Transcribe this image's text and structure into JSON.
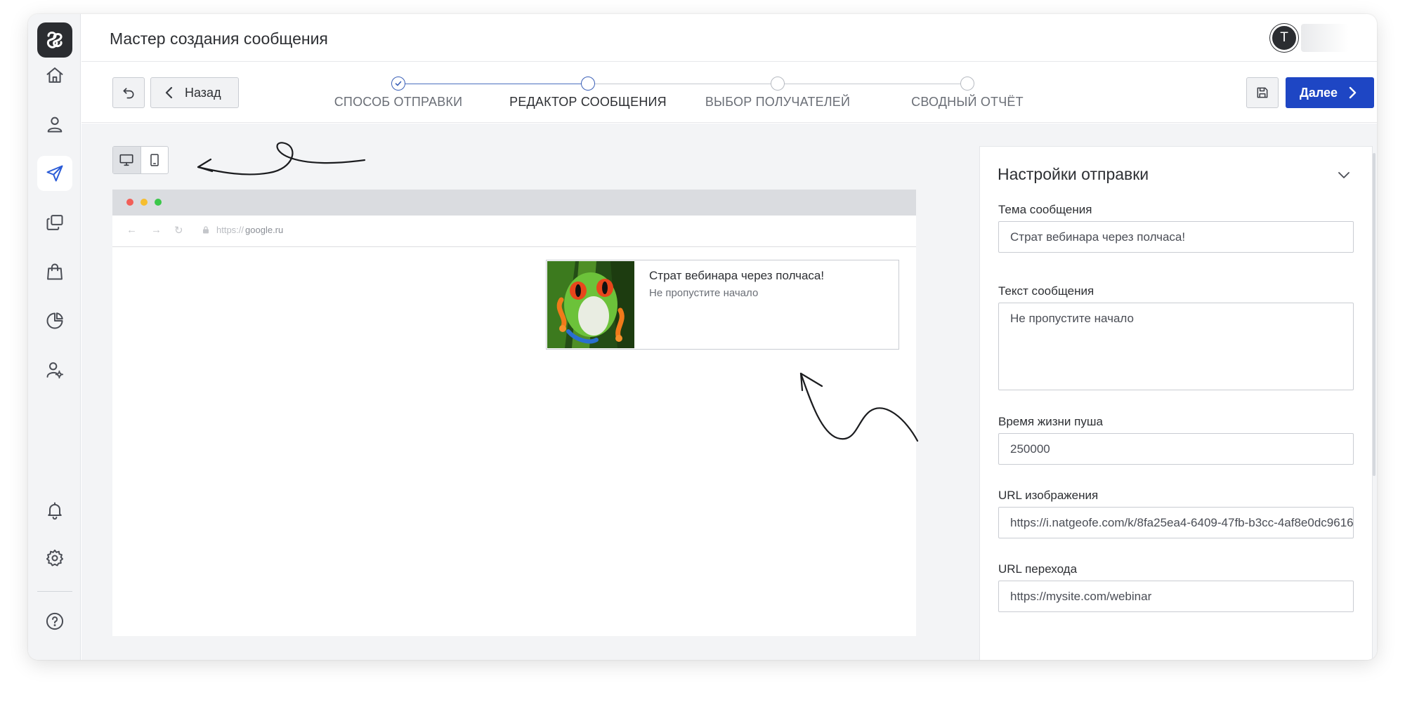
{
  "header": {
    "title": "Мастер создания сообщения",
    "avatar_initial": "T"
  },
  "sidebar": {
    "items": [
      {
        "icon": "home-icon"
      },
      {
        "icon": "user-icon"
      },
      {
        "icon": "send-icon",
        "active": true
      },
      {
        "icon": "copy-icon"
      },
      {
        "icon": "bag-icon"
      },
      {
        "icon": "pie-chart-icon"
      },
      {
        "icon": "user-settings-icon"
      }
    ],
    "bottom_items": [
      {
        "icon": "bell-icon"
      },
      {
        "icon": "gear-icon"
      },
      {
        "icon": "help-icon"
      }
    ]
  },
  "toolbar": {
    "back_label": "Назад",
    "next_label": "Далее",
    "steps": [
      {
        "label": "СПОСОБ ОТПРАВКИ",
        "state": "done"
      },
      {
        "label": "РЕДАКТОР СООБЩЕНИЯ",
        "state": "current"
      },
      {
        "label": "ВЫБОР ПОЛУЧАТЕЛЕЙ",
        "state": "pending"
      },
      {
        "label": "СВОДНЫЙ ОТЧЁТ",
        "state": "pending"
      }
    ]
  },
  "preview": {
    "url_scheme": "https://",
    "url_host": "google.ru",
    "push_title": "Страт вебинара через полчаса!",
    "push_text": "Не пропустите начало"
  },
  "settings": {
    "title": "Настройки отправки",
    "subject_label": "Тема сообщения",
    "subject_value": "Страт вебинара через полчаса!",
    "text_label": "Текст сообщения",
    "text_value": "Не пропустите начало",
    "ttl_label": "Время жизни пуша",
    "ttl_value": "250000",
    "image_url_label": "URL изображения",
    "image_url_value": "https://i.natgeofe.com/k/8fa25ea4-6409-47fb-b3cc-4af8e0dc9616",
    "link_url_label": "URL перехода",
    "link_url_value": "https://mysite.com/webinar"
  },
  "colors": {
    "primary": "#1e46c4",
    "active_icon": "#2a5bd7",
    "sidebar_bg": "#f3f4f6"
  }
}
